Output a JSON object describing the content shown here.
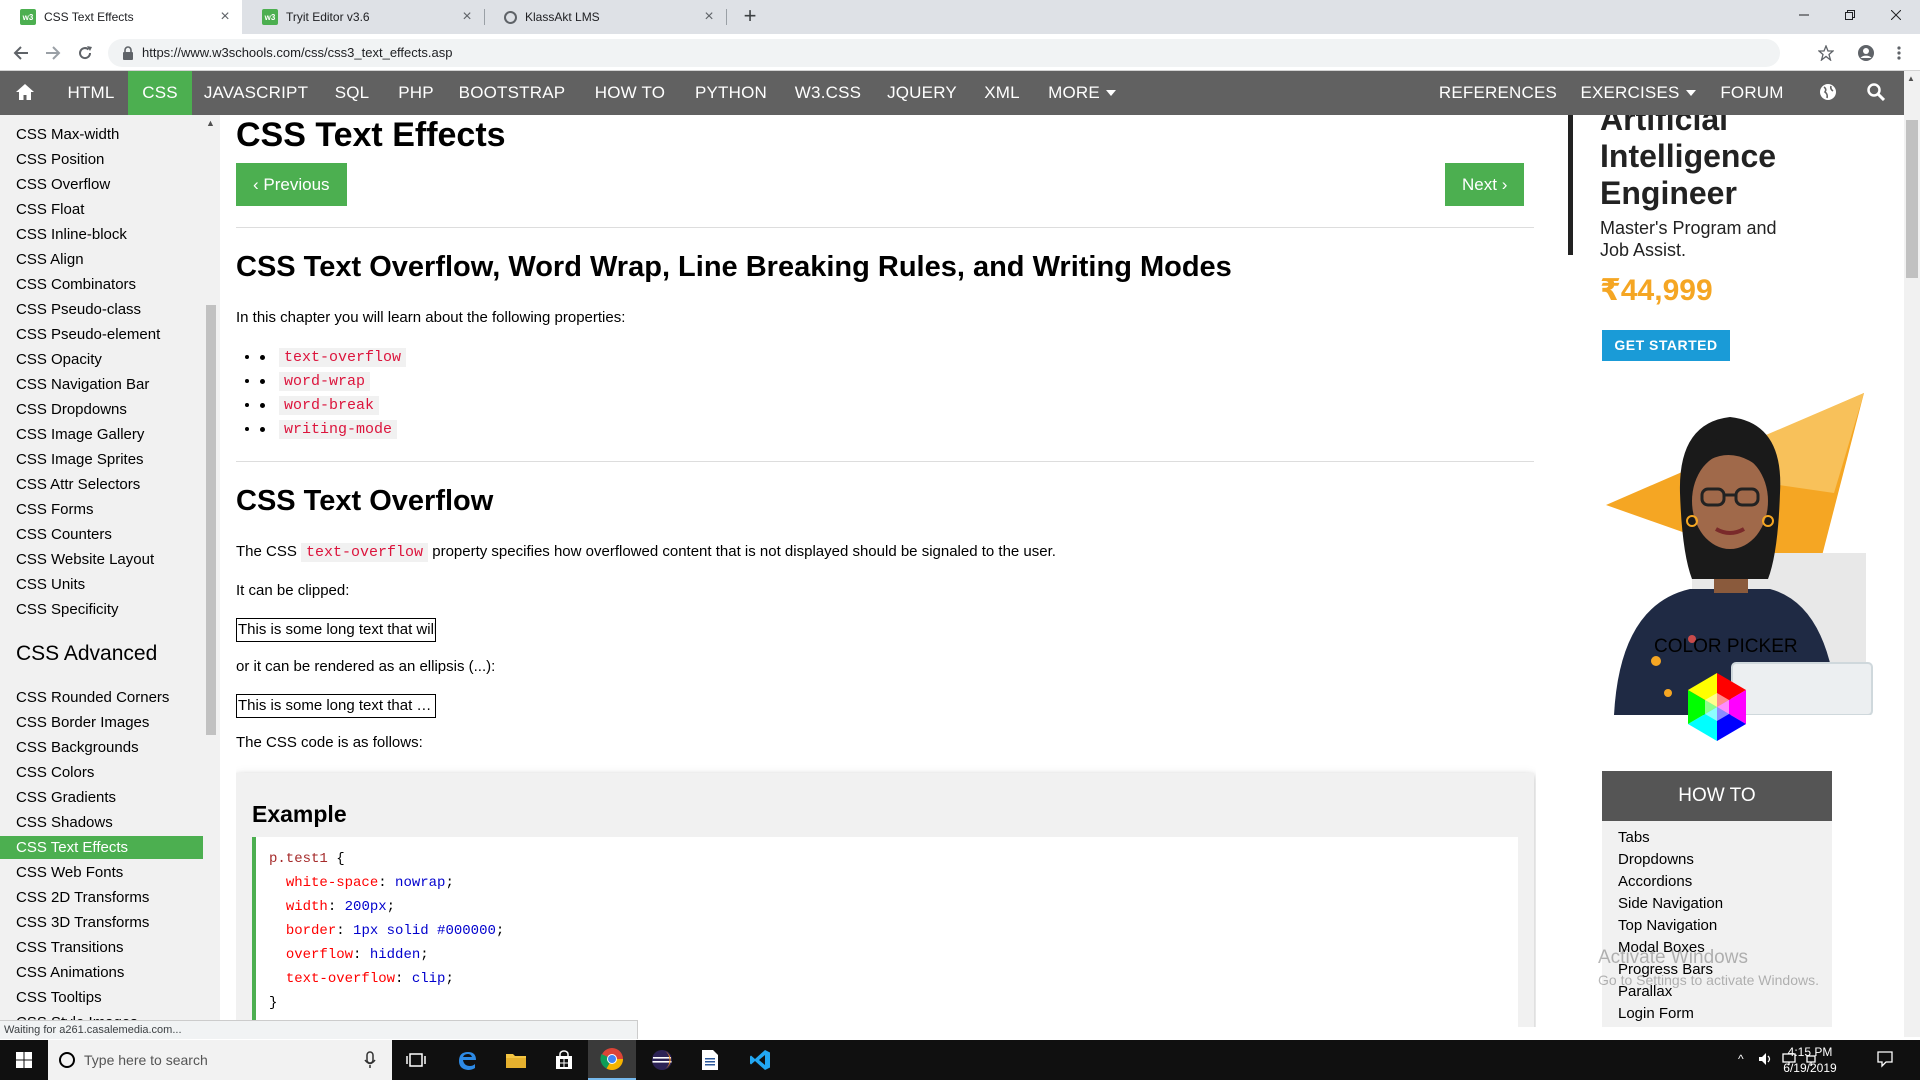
{
  "browser": {
    "tabs": [
      {
        "title": "CSS Text Effects",
        "active": true
      },
      {
        "title": "Tryit Editor v3.6",
        "active": false
      },
      {
        "title": "KlassAkt LMS",
        "active": false
      }
    ],
    "url": "https://www.w3schools.com/css/css3_text_effects.asp",
    "status": "Waiting for a261.casalemedia.com..."
  },
  "topnav": {
    "items": [
      "HTML",
      "CSS",
      "JAVASCRIPT",
      "SQL",
      "PHP",
      "BOOTSTRAP",
      "HOW TO",
      "PYTHON",
      "W3.CSS",
      "JQUERY",
      "XML",
      "MORE"
    ],
    "active": "CSS",
    "right_items": [
      "REFERENCES",
      "EXERCISES",
      "FORUM"
    ]
  },
  "sidebar": {
    "items_top": [
      "CSS Max-width",
      "CSS Position",
      "CSS Overflow",
      "CSS Float",
      "CSS Inline-block",
      "CSS Align",
      "CSS Combinators",
      "CSS Pseudo-class",
      "CSS Pseudo-element",
      "CSS Opacity",
      "CSS Navigation Bar",
      "CSS Dropdowns",
      "CSS Image Gallery",
      "CSS Image Sprites",
      "CSS Attr Selectors",
      "CSS Forms",
      "CSS Counters",
      "CSS Website Layout",
      "CSS Units",
      "CSS Specificity"
    ],
    "advanced_heading": "CSS Advanced",
    "items_advanced": [
      "CSS Rounded Corners",
      "CSS Border Images",
      "CSS Backgrounds",
      "CSS Colors",
      "CSS Gradients",
      "CSS Shadows",
      "CSS Text Effects",
      "CSS Web Fonts",
      "CSS 2D Transforms",
      "CSS 3D Transforms",
      "CSS Transitions",
      "CSS Animations",
      "CSS Tooltips",
      "CSS Style Images"
    ],
    "active": "CSS Text Effects"
  },
  "main": {
    "title": "CSS Text Effects",
    "prev_label": "Previous",
    "next_label": "Next",
    "section1_title": "CSS Text Overflow, Word Wrap, Line Breaking Rules, and Writing Modes",
    "intro": "In this chapter you will learn about the following properties:",
    "properties": [
      "text-overflow",
      "word-wrap",
      "word-break",
      "writing-mode"
    ],
    "section2_title": "CSS Text Overflow",
    "desc_pre": "The CSS",
    "desc_code": "text-overflow",
    "desc_post": "property specifies how overflowed content that is not displayed should be signaled to the user.",
    "clipped_label": "It can be clipped:",
    "demo_clip_text": "This is some long text that will not fit in the box",
    "ellipsis_label": "or it can be rendered as an ellipsis (...):",
    "demo_ellipsis_text": "This is some long text that will not fit in the box",
    "code_intro": "The CSS code is as follows:",
    "example_title": "Example",
    "code": {
      "selector": "p.test1",
      "open": "{",
      "close": "}",
      "decls": [
        {
          "prop": "white-space",
          "val": "nowrap"
        },
        {
          "prop": "width",
          "val": "200px"
        },
        {
          "prop": "border",
          "val": "1px solid #000000"
        },
        {
          "prop": "overflow",
          "val": "hidden"
        },
        {
          "prop": "text-overflow",
          "val": "clip"
        }
      ]
    }
  },
  "ad": {
    "headline_lines": [
      "Artificial",
      "Intelligence",
      "Engineer"
    ],
    "sub_lines": [
      "Master's Program and",
      "Job Assist."
    ],
    "price": "₹44,999",
    "cta": "GET STARTED"
  },
  "right_sidebar": {
    "color_picker_title": "COLOR PICKER",
    "howto_title": "HOW TO",
    "howto_items": [
      "Tabs",
      "Dropdowns",
      "Accordions",
      "Side Navigation",
      "Top Navigation",
      "Modal Boxes",
      "Progress Bars",
      "Parallax",
      "Login Form"
    ]
  },
  "watermark": {
    "line1": "Activate Windows",
    "line2": "Go to Settings to activate Windows."
  },
  "taskbar": {
    "search_placeholder": "Type here to search",
    "time": "4:15 PM",
    "date": "6/19/2019"
  },
  "colors": {
    "w3_green": "#4CAF50",
    "nav_gray": "#616161",
    "sidebar_bg": "#f1f1f1",
    "code_red": "#dc143c",
    "ad_orange": "#f5a623",
    "ad_blue": "#1a9bd7"
  }
}
